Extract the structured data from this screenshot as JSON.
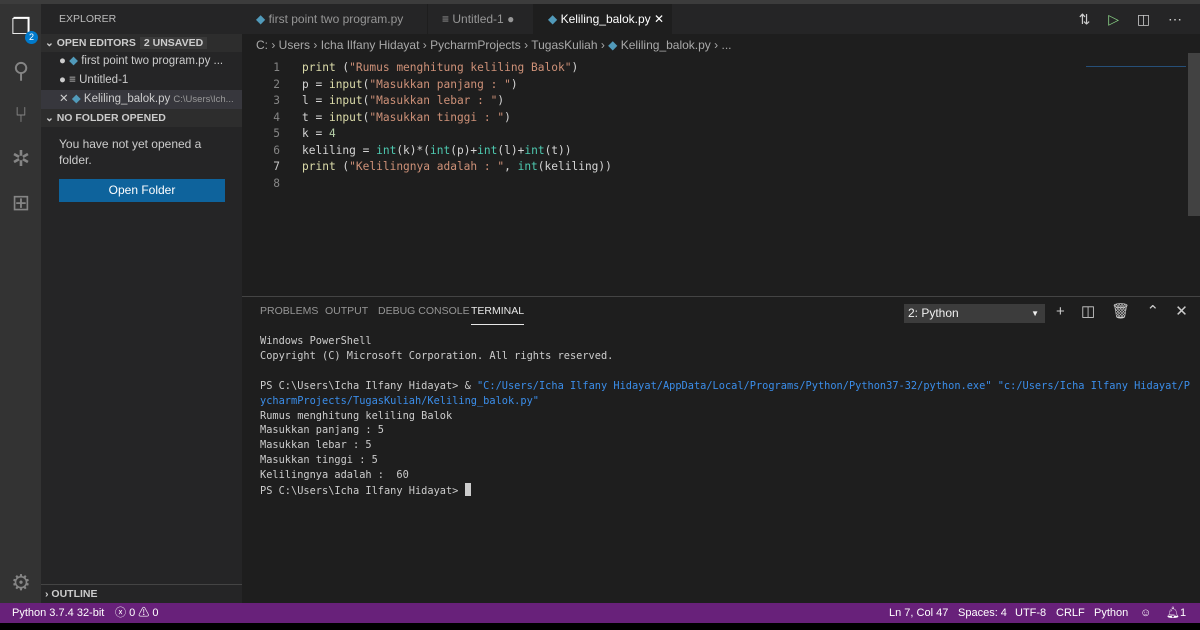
{
  "activity_bar": {
    "explorer_badge": "2",
    "items": [
      "explorer-icon",
      "search-icon",
      "source-control-icon",
      "debug-icon",
      "extensions-icon",
      "settings-icon"
    ]
  },
  "sidebar": {
    "title": "EXPLORER",
    "open_editors": {
      "label": "OPEN EDITORS",
      "unsaved": "2 UNSAVED",
      "items": [
        {
          "name": "first point two program.py",
          "suffix": "...",
          "state": "dirty"
        },
        {
          "name": "Untitled-1",
          "state": "dirty"
        },
        {
          "name": "Keliling_balok.py",
          "path": "C:\\Users\\Ich...",
          "state": "active"
        }
      ]
    },
    "no_folder": {
      "label": "NO FOLDER OPENED",
      "message": "You have not yet opened a folder.",
      "button": "Open Folder"
    },
    "outline": "OUTLINE"
  },
  "tabs": [
    {
      "label": "first point two program.py",
      "dirty": true
    },
    {
      "label": "Untitled-1",
      "dirty": true
    },
    {
      "label": "Keliling_balok.py",
      "active": true
    }
  ],
  "breadcrumb": [
    "C:",
    "Users",
    "Icha Ilfany Hidayat",
    "PycharmProjects",
    "TugasKuliah",
    "Keliling_balok.py",
    "..."
  ],
  "editor": {
    "lines": [
      "print (\"Rumus menghitung keliling Balok\")",
      "p = input(\"Masukkan panjang : \")",
      "l = input(\"Masukkan lebar : \")",
      "t = input(\"Masukkan tinggi : \")",
      "k = 4",
      "keliling = int(k)*(int(p)+int(l)+int(t))",
      "print (\"Kelilingnya adalah : \", int(keliling))",
      ""
    ],
    "current_line": 7
  },
  "panel": {
    "tabs": [
      "PROBLEMS",
      "OUTPUT",
      "DEBUG CONSOLE",
      "TERMINAL"
    ],
    "active": "TERMINAL",
    "terminal_select": "2: Python",
    "terminal": {
      "l1": "Windows PowerShell",
      "l2": "Copyright (C) Microsoft Corporation. All rights reserved.",
      "prompt": "PS C:\\Users\\Icha Ilfany Hidayat> & ",
      "cmd1": "\"C:/Users/Icha Ilfany Hidayat/AppData/Local/Programs/Python/Python37-32/python.exe\" \"c:/Users/Icha Ilfany Hidayat/P",
      "cmd2": "ycharmProjects/TugasKuliah/Keliling_balok.py\"",
      "o1": "Rumus menghitung keliling Balok",
      "o2": "Masukkan panjang : 5",
      "o3": "Masukkan lebar : 5",
      "o4": "Masukkan tinggi : 5",
      "o5": "Kelilingnya adalah :  60",
      "last": "PS C:\\Users\\Icha Ilfany Hidayat> "
    }
  },
  "status": {
    "interpreter": "Python 3.7.4 32-bit",
    "errors": "0",
    "warnings": "0",
    "position": "Ln 7, Col 47",
    "spaces": "Spaces: 4",
    "encoding": "UTF-8",
    "eol": "CRLF",
    "language": "Python",
    "notifications": "1",
    "color": "#68217a"
  }
}
